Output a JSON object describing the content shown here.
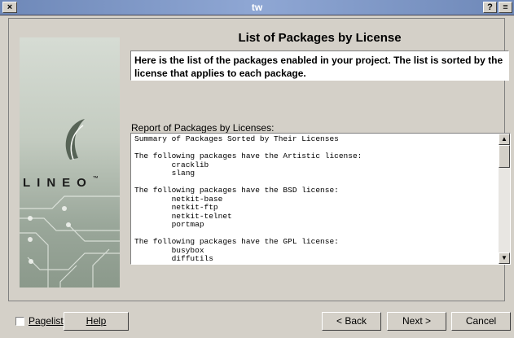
{
  "window": {
    "title": "tw",
    "close_glyph": "×",
    "help_glyph": "?",
    "menu_glyph": "≡"
  },
  "logo": {
    "text": "LINEO",
    "trademark": "™"
  },
  "page": {
    "title": "List of Packages by License",
    "description": "Here is the list of the packages enabled in your project. The list is sorted by the license that applies to each package."
  },
  "report": {
    "label": "Report of Packages by Licenses:",
    "content": "Summary of Packages Sorted by Their Licenses\n\nThe following packages have the Artistic license:\n        cracklib\n        slang\n\nThe following packages have the BSD license:\n        netkit-base\n        netkit-ftp\n        netkit-telnet\n        portmap\n\nThe following packages have the GPL license:\n        busybox\n        diffutils"
  },
  "footer": {
    "pagelist": "Pagelist",
    "help": "Help",
    "back": "< Back",
    "next": "Next >",
    "cancel": "Cancel"
  }
}
